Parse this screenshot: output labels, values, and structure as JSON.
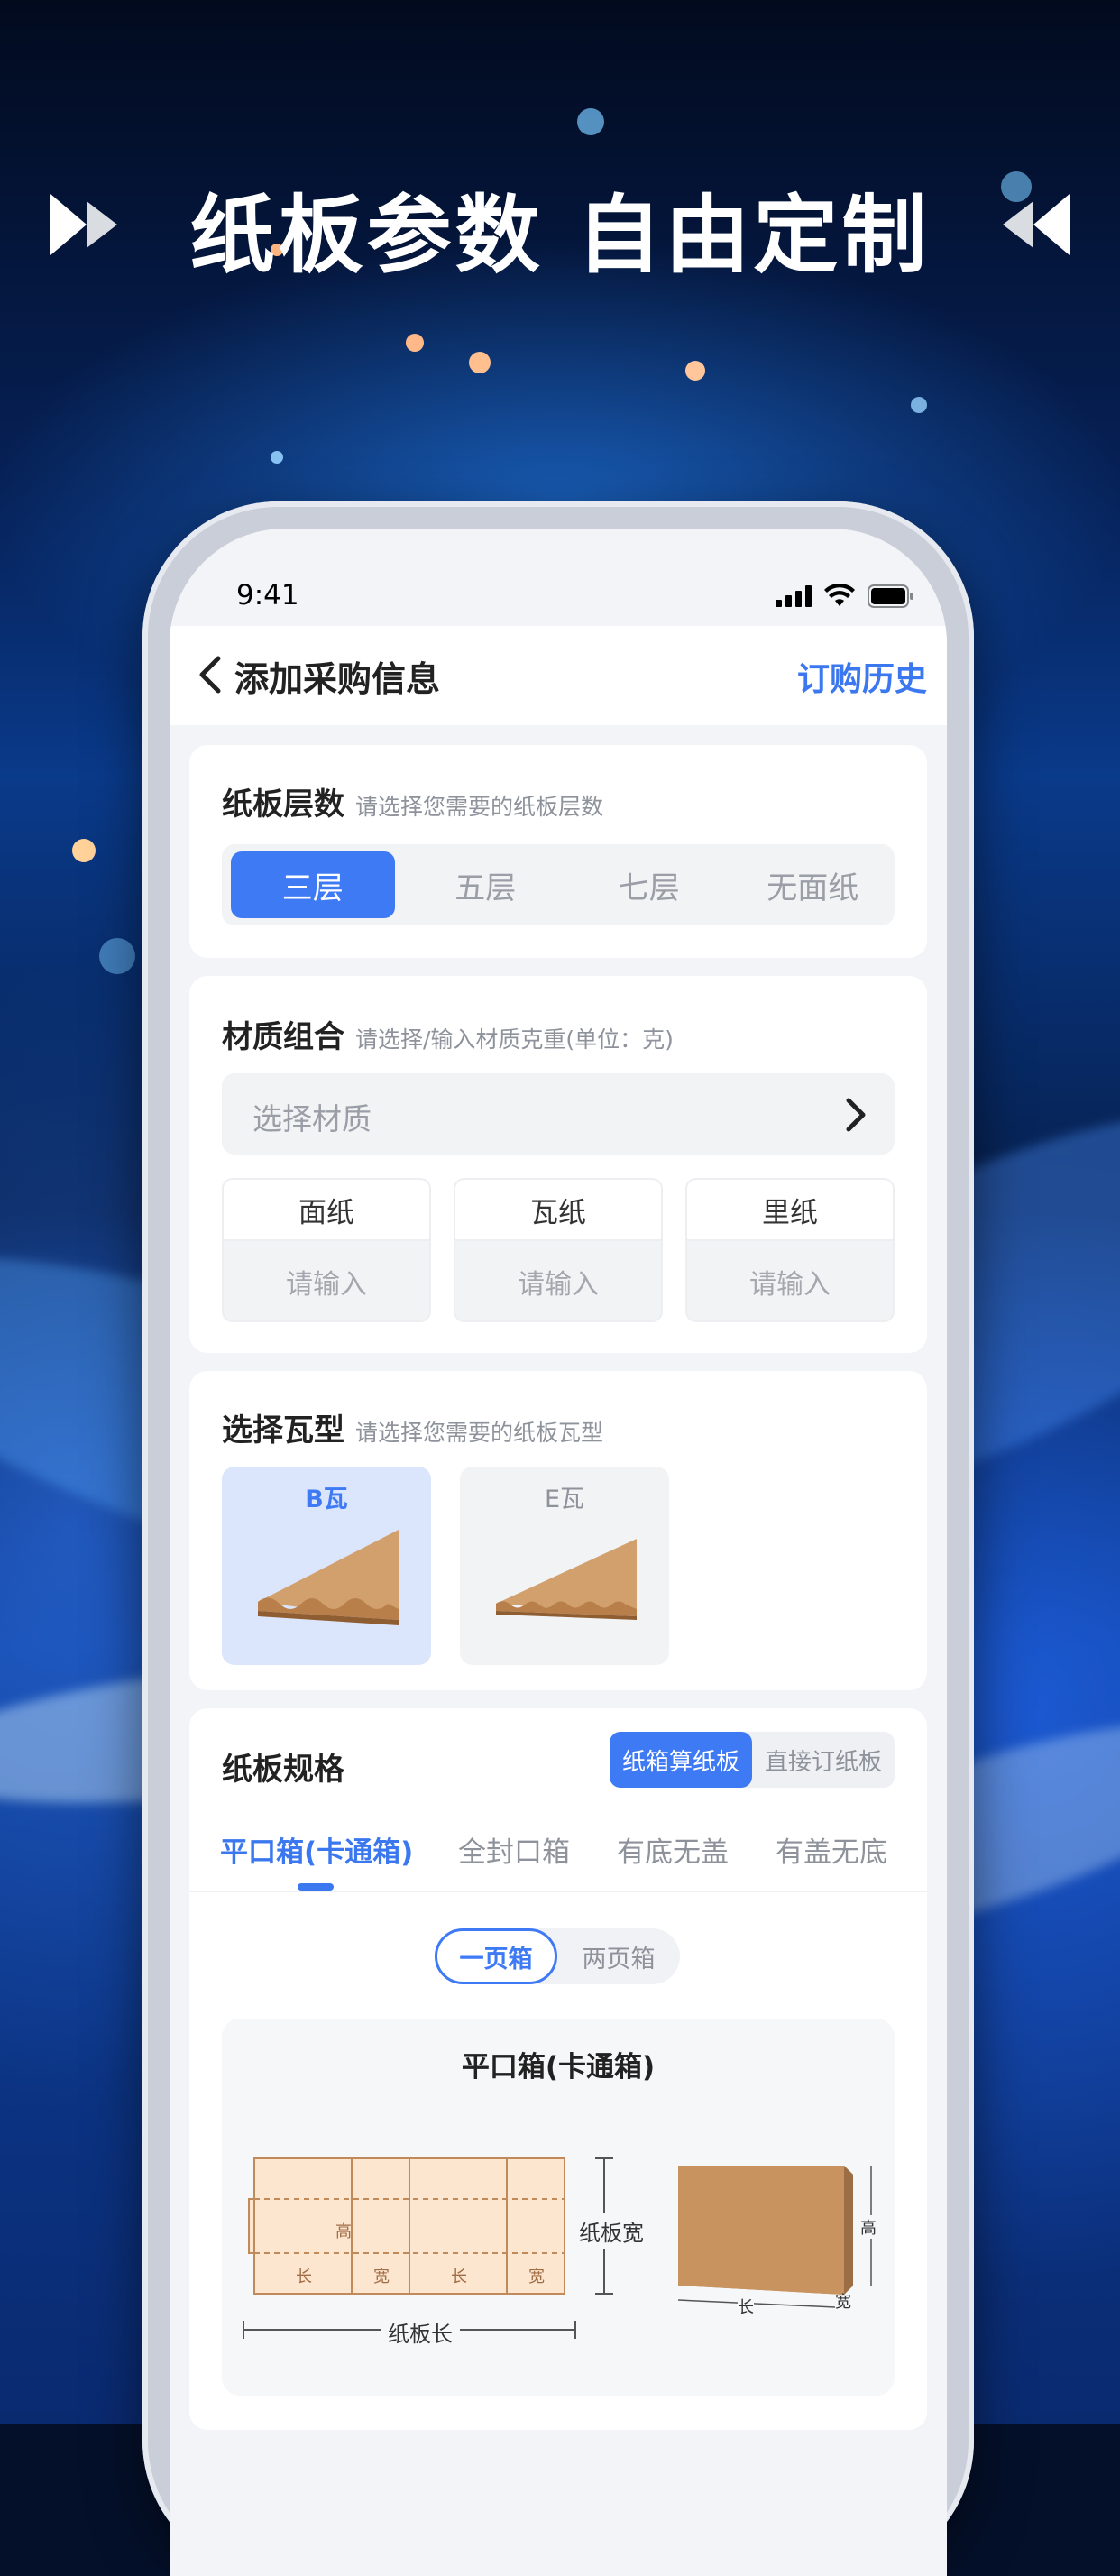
{
  "headline": "纸板参数 自由定制",
  "status": {
    "time": "9:41"
  },
  "nav": {
    "title": "添加采购信息",
    "history": "订购历史"
  },
  "layers": {
    "title": "纸板层数",
    "hint": "请选择您需要的纸板层数",
    "options": [
      "三层",
      "五层",
      "七层",
      "无面纸"
    ],
    "selected": "三层"
  },
  "material": {
    "title": "材质组合",
    "hint": "请选择/输入材质克重(单位：克)",
    "select_placeholder": "选择材质",
    "fields": [
      {
        "label": "面纸",
        "placeholder": "请输入"
      },
      {
        "label": "瓦纸",
        "placeholder": "请输入"
      },
      {
        "label": "里纸",
        "placeholder": "请输入"
      }
    ]
  },
  "flute": {
    "title": "选择瓦型",
    "hint": "请选择您需要的纸板瓦型",
    "options": [
      "B瓦",
      "E瓦"
    ],
    "selected": "B瓦"
  },
  "spec": {
    "title": "纸板规格",
    "modes": [
      "纸箱算纸板",
      "直接订纸板"
    ],
    "mode_selected": "纸箱算纸板",
    "tabs": [
      "平口箱(卡通箱)",
      "全封口箱",
      "有底无盖",
      "有盖无底"
    ],
    "tab_selected": "平口箱(卡通箱)",
    "page_options": [
      "一页箱",
      "两页箱"
    ],
    "page_selected": "一页箱",
    "diagram_title": "平口箱(卡通箱)",
    "diagram_labels": {
      "height": "高",
      "length": "长",
      "width": "宽",
      "board_width": "纸板宽",
      "board_length": "纸板长"
    }
  },
  "colors": {
    "accent": "#3f7af5",
    "selected_bg": "#dbe5fb",
    "kraft": "#c8935e"
  }
}
